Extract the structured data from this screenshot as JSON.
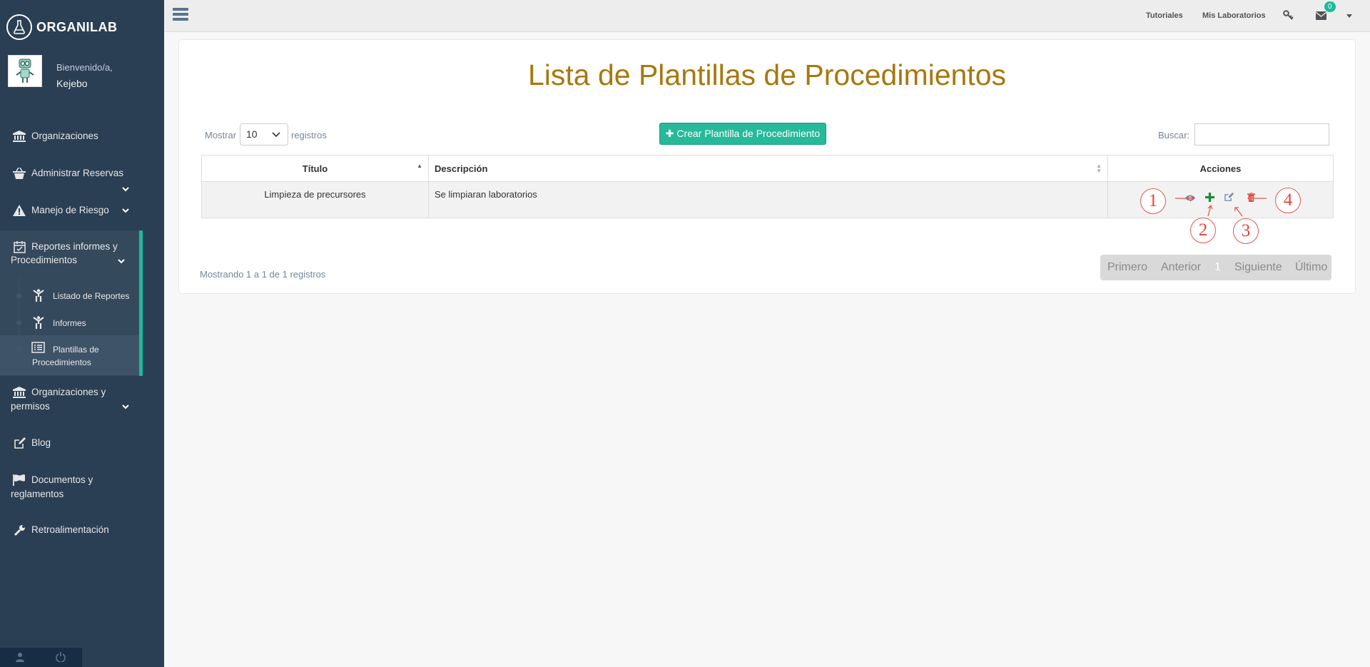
{
  "app": {
    "name": "ORGANILAB"
  },
  "profile": {
    "welcome": "Bienvenido/a,",
    "username": "Kejebo"
  },
  "sidebar": {
    "items": [
      {
        "label": "Organizaciones",
        "icon": "bank-icon"
      },
      {
        "label": "Administrar Reservas",
        "icon": "basket-icon"
      },
      {
        "label": "Manejo de Riesgo",
        "icon": "warning-icon"
      },
      {
        "label_line1": "Reportes informes y",
        "label_line2": "Procedimientos",
        "icon": "calendar-check-icon"
      },
      {
        "label_line1": "Organizaciones y",
        "label_line2": "permisos",
        "icon": "bank-icon"
      },
      {
        "label": "Blog",
        "icon": "edit-icon"
      },
      {
        "label_line1": "Documentos y",
        "label_line2": "reglamentos",
        "icon": "flag-icon"
      },
      {
        "label": "Retroalimentación",
        "icon": "wrench-icon"
      }
    ],
    "subitems": [
      {
        "label": "Listado de Reportes"
      },
      {
        "label": "Informes"
      },
      {
        "label_line1": "Plantillas de",
        "label_line2": "Procedimientos"
      }
    ]
  },
  "topnav": {
    "links": [
      "Tutoriales",
      "Mis Laboratorios"
    ],
    "mail_count": "0"
  },
  "page": {
    "title": "Lista de Plantillas de Procedimientos",
    "show_label": "Mostrar",
    "page_size": "10",
    "records_label": "registros",
    "create_button": "Crear Plantilla de Procedimiento",
    "search_label": "Buscar:",
    "search_value": ""
  },
  "table": {
    "headers": [
      "Título",
      "Descripción",
      "Acciones"
    ],
    "rows": [
      {
        "title": "Limpieza de precursores",
        "description": "Se limpiaran laboratorios"
      }
    ]
  },
  "annotations": [
    "1",
    "2",
    "3",
    "4"
  ],
  "footer": {
    "info": "Mostrando 1 a 1 de 1 registros",
    "pager": [
      "Primero",
      "Anterior",
      "1",
      "Siguiente",
      "Último"
    ]
  },
  "colors": {
    "sidebar": "#2a3f54",
    "accent": "#1abb9c",
    "title": "#a8780d",
    "create_button": "#26b99a",
    "annotation": "#e8403a"
  }
}
